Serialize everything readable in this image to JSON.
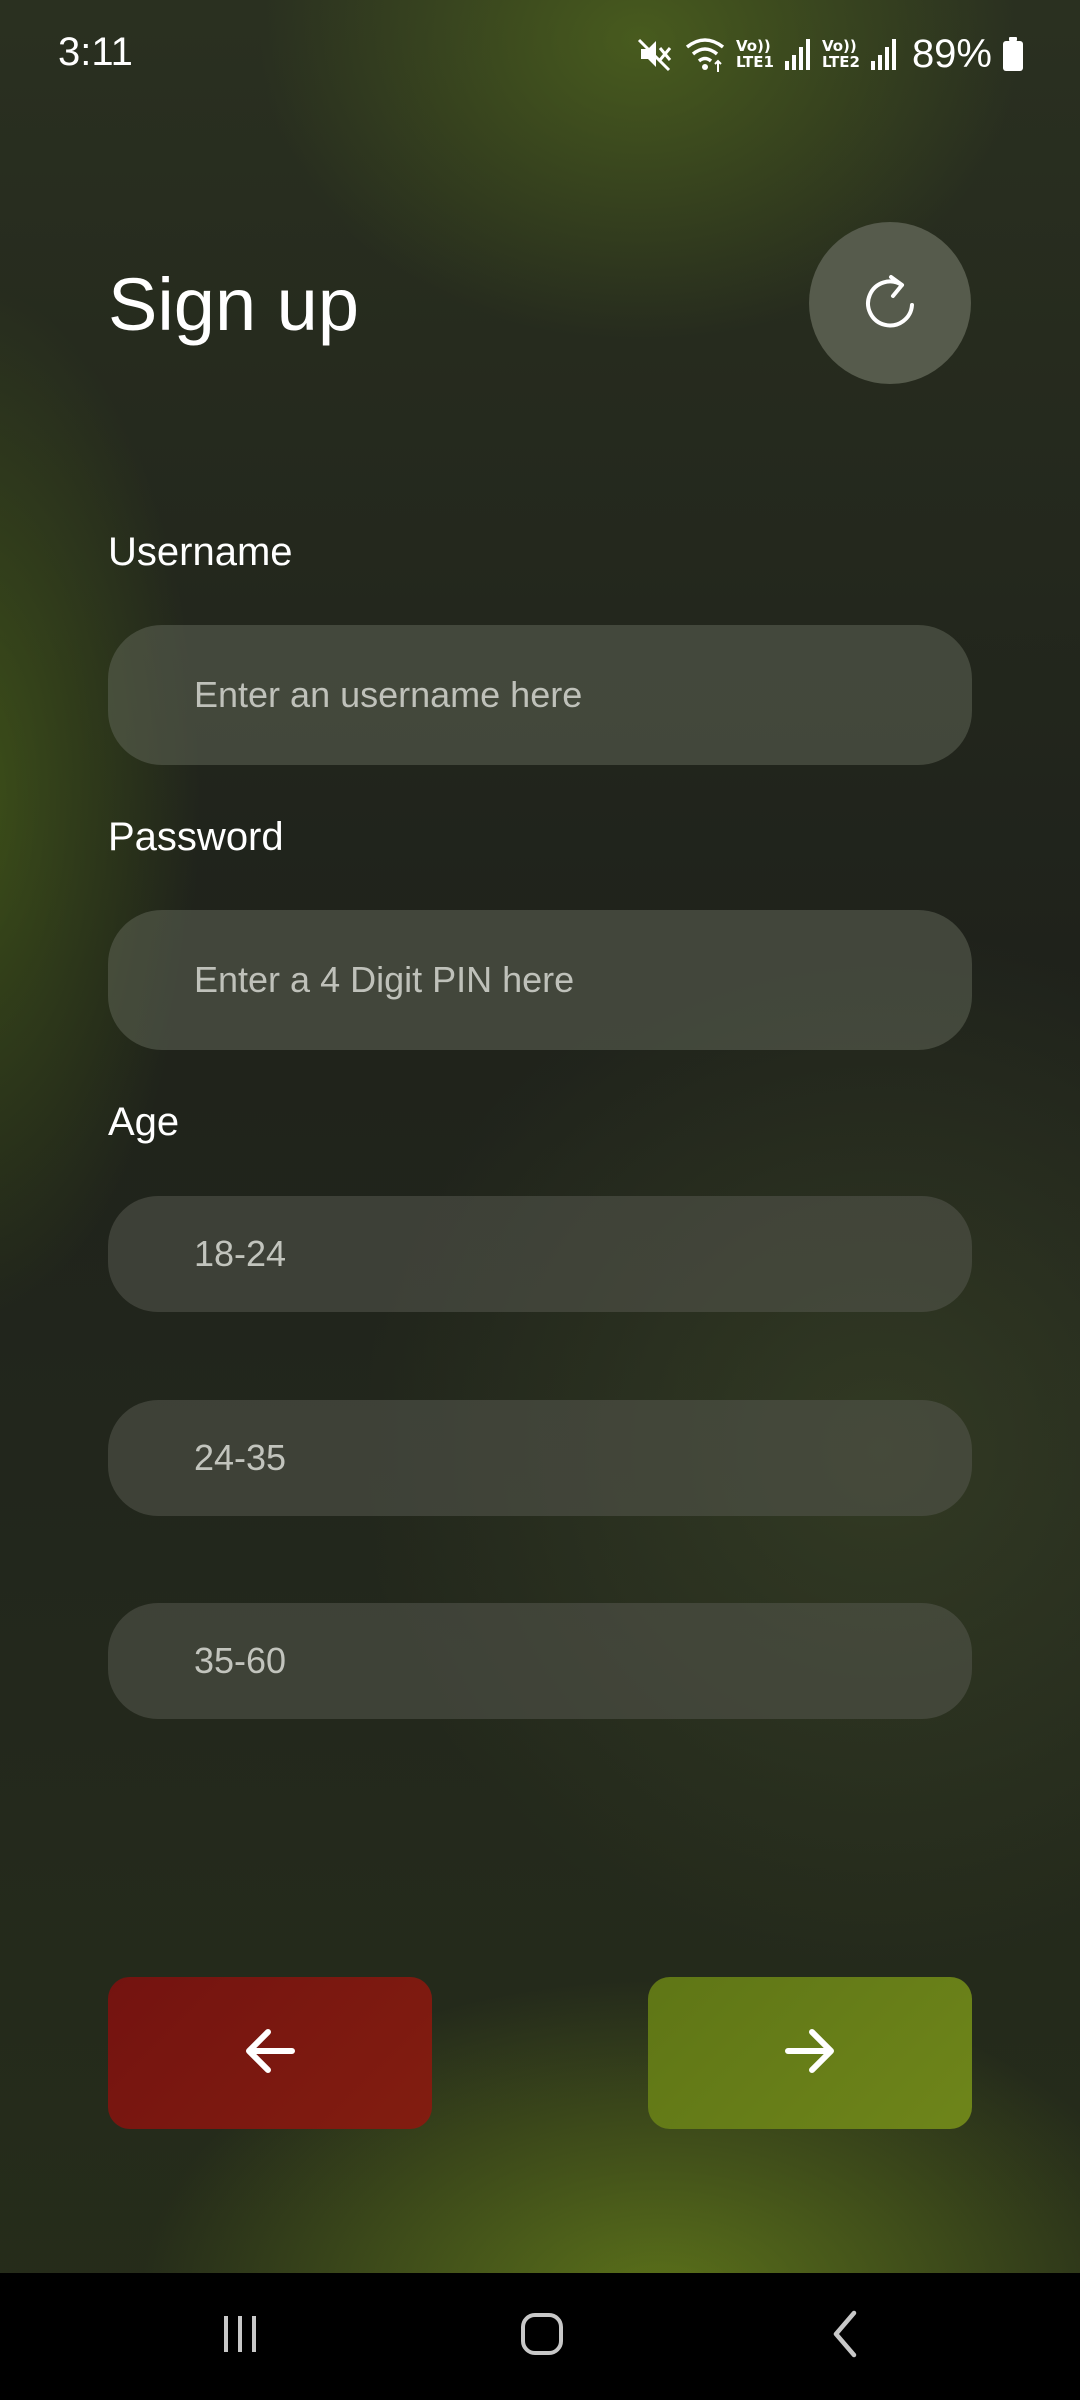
{
  "status_bar": {
    "time": "3:11",
    "sim1_top": "Vo))",
    "sim1_bottom": "LTE1",
    "sim2_top": "Vo))",
    "sim2_bottom": "LTE2",
    "battery": "89%",
    "icons": [
      "mute-icon",
      "wifi-icon",
      "signal-icon",
      "battery-icon"
    ]
  },
  "header": {
    "title": "Sign up",
    "refresh_icon": "refresh-icon"
  },
  "form": {
    "username_label": "Username",
    "username_placeholder": "Enter an username here",
    "password_label": "Password",
    "password_placeholder": "Enter a 4 Digit PIN here",
    "age_label": "Age",
    "age_options": [
      "18-24",
      "24-35",
      "35-60"
    ]
  },
  "actions": {
    "back_icon": "arrow-left-icon",
    "next_icon": "arrow-right-icon",
    "back_color": "#7a1710",
    "next_color": "#67801a"
  },
  "nav_bar": {
    "icons": [
      "recent-apps-icon",
      "home-icon",
      "back-icon"
    ]
  }
}
